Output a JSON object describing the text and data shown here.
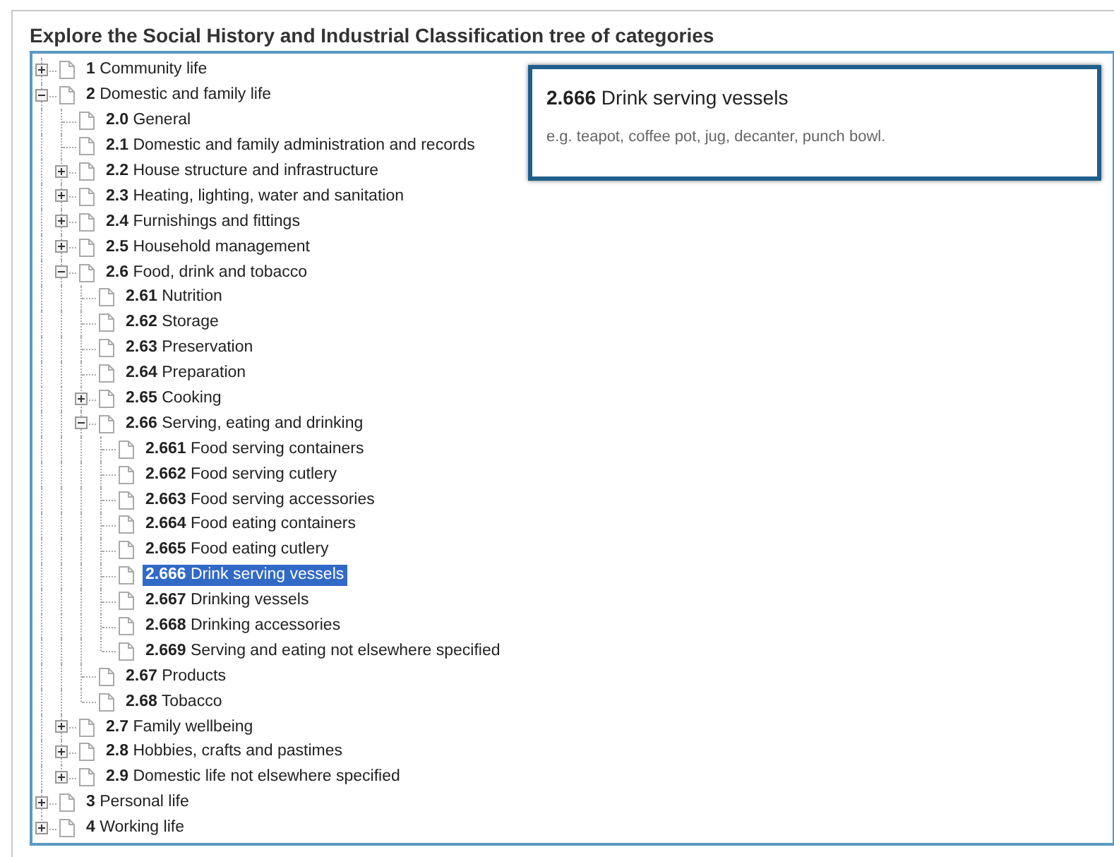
{
  "heading": "Explore the Social History and Industrial Classification tree of categories",
  "tree": [
    {
      "kind": "branch",
      "label": "**1** Community life",
      "expanded": false,
      "selected": false
    },
    {
      "kind": "branch",
      "label": "**2** Domestic and family life",
      "expanded": true,
      "selected": false,
      "children": [
        {
          "kind": "leaf",
          "label": "**2.0** General",
          "selected": false
        },
        {
          "kind": "leaf",
          "label": "**2.1** Domestic and family administration and records",
          "selected": false
        },
        {
          "kind": "branch",
          "label": "**2.2** House structure and infrastructure",
          "expanded": false,
          "selected": false
        },
        {
          "kind": "branch",
          "label": "**2.3** Heating, lighting, water and sanitation",
          "expanded": false,
          "selected": false
        },
        {
          "kind": "branch",
          "label": "**2.4** Furnishings and fittings",
          "expanded": false,
          "selected": false
        },
        {
          "kind": "branch",
          "label": "**2.5** Household management",
          "expanded": false,
          "selected": false
        },
        {
          "kind": "branch",
          "label": "**2.6** Food, drink and tobacco",
          "expanded": true,
          "selected": false,
          "children": [
            {
              "kind": "leaf",
              "label": "**2.61** Nutrition",
              "selected": false
            },
            {
              "kind": "leaf",
              "label": "**2.62** Storage",
              "selected": false
            },
            {
              "kind": "leaf",
              "label": "**2.63** Preservation",
              "selected": false
            },
            {
              "kind": "leaf",
              "label": "**2.64** Preparation",
              "selected": false
            },
            {
              "kind": "branch",
              "label": "**2.65** Cooking",
              "expanded": false,
              "selected": false
            },
            {
              "kind": "branch",
              "label": "**2.66** Serving, eating and drinking",
              "expanded": true,
              "selected": false,
              "children": [
                {
                  "kind": "leaf",
                  "label": "**2.661** Food serving containers",
                  "selected": false
                },
                {
                  "kind": "leaf",
                  "label": "**2.662** Food serving cutlery",
                  "selected": false
                },
                {
                  "kind": "leaf",
                  "label": "**2.663** Food serving accessories",
                  "selected": false
                },
                {
                  "kind": "leaf",
                  "label": "**2.664** Food eating containers",
                  "selected": false
                },
                {
                  "kind": "leaf",
                  "label": "**2.665** Food eating cutlery",
                  "selected": false
                },
                {
                  "kind": "leaf",
                  "label": "**2.666** Drink serving vessels",
                  "selected": true
                },
                {
                  "kind": "leaf",
                  "label": "**2.667** Drinking vessels",
                  "selected": false
                },
                {
                  "kind": "leaf",
                  "label": "**2.668** Drinking accessories",
                  "selected": false
                },
                {
                  "kind": "leaf",
                  "label": "**2.669** Serving and eating not elsewhere specified",
                  "selected": false
                }
              ]
            },
            {
              "kind": "leaf",
              "label": "**2.67** Products",
              "selected": false
            },
            {
              "kind": "leaf",
              "label": "**2.68** Tobacco",
              "selected": false
            }
          ]
        },
        {
          "kind": "branch",
          "label": "**2.7** Family wellbeing",
          "expanded": false,
          "selected": false
        },
        {
          "kind": "branch",
          "label": "**2.8** Hobbies, crafts and pastimes",
          "expanded": false,
          "selected": false
        },
        {
          "kind": "branch",
          "label": "**2.9** Domestic life not elsewhere specified",
          "expanded": false,
          "selected": false
        }
      ]
    },
    {
      "kind": "branch",
      "label": "**3** Personal life",
      "expanded": false,
      "selected": false
    },
    {
      "kind": "branch",
      "label": "**4** Working life",
      "expanded": false,
      "selected": false
    }
  ],
  "detail": {
    "title": "**2.666** Drink serving vessels",
    "description": "e.g. teapot, coffee pot, jug, decanter, punch bowl."
  }
}
